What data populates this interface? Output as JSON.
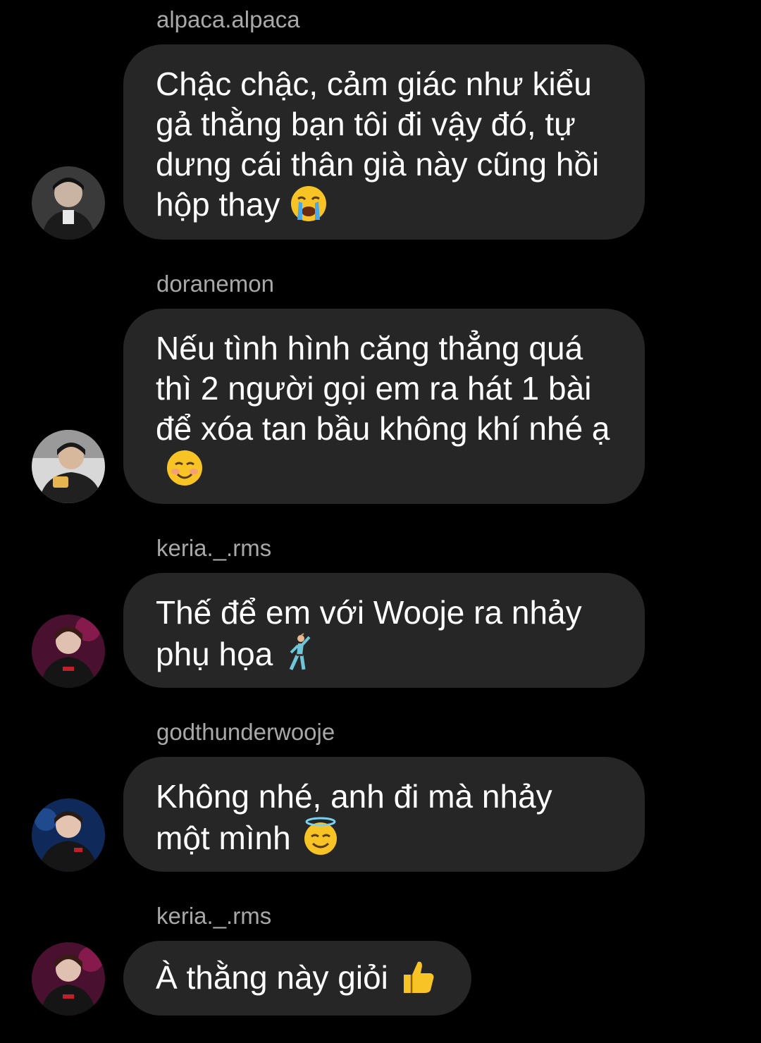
{
  "messages": [
    {
      "sender": "alpaca.alpaca",
      "text": "Chậc chậc, cảm giác như kiểu gả thằng bạn tôi đi vậy đó, tự dưng cái thân già này cũng hồi hộp thay",
      "emoji": "crying-face-emoji"
    },
    {
      "sender": "doranemon",
      "text": "Nếu tình hình căng thẳng quá thì 2 người gọi em ra hát 1 bài để xóa tan bầu không khí nhé ạ",
      "emoji": "smiling-face-emoji"
    },
    {
      "sender": "keria._.rms",
      "text": "Thế để em với Wooje ra nhảy phụ họa",
      "emoji": "dancing-man-emoji"
    },
    {
      "sender": "godthunderwooje",
      "text": "Không nhé, anh đi mà nhảy một mình",
      "emoji": "halo-face-emoji"
    },
    {
      "sender": "keria._.rms",
      "text": "À thằng này giỏi",
      "emoji": "thumbs-up-emoji"
    }
  ],
  "colors": {
    "background": "#000000",
    "bubble": "#262626",
    "text": "#ffffff",
    "sender": "#a8a8a8"
  }
}
